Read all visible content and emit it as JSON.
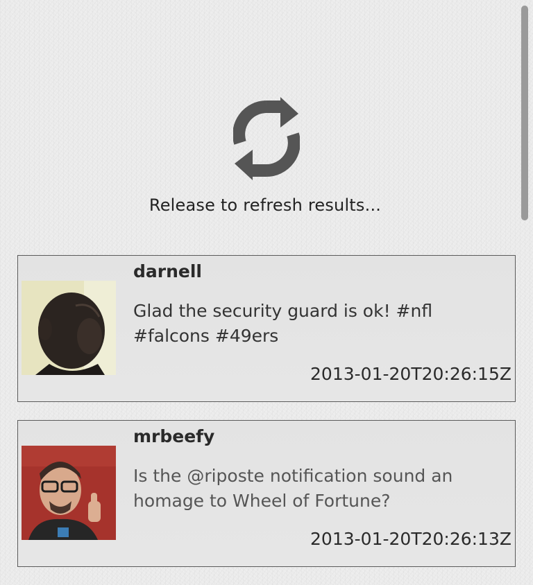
{
  "refresh": {
    "icon": "refresh-icon",
    "label": "Release to refresh results..."
  },
  "posts": [
    {
      "username": "darnell",
      "message": "Glad the security guard is ok! #nfl #falcons #49ers",
      "timestamp": "2013-01-20T20:26:15Z",
      "avatar": "user-avatar-darnell"
    },
    {
      "username": "mrbeefy",
      "message": "Is the @riposte notification sound an homage to Wheel of Fortune?",
      "timestamp": "2013-01-20T20:26:13Z",
      "avatar": "user-avatar-mrbeefy"
    }
  ],
  "colors": {
    "background": "#ebebeb",
    "card_background": "#e4e4e4",
    "card_border": "#5a5a5a",
    "icon": "#555555",
    "text": "#2a2a2a"
  }
}
